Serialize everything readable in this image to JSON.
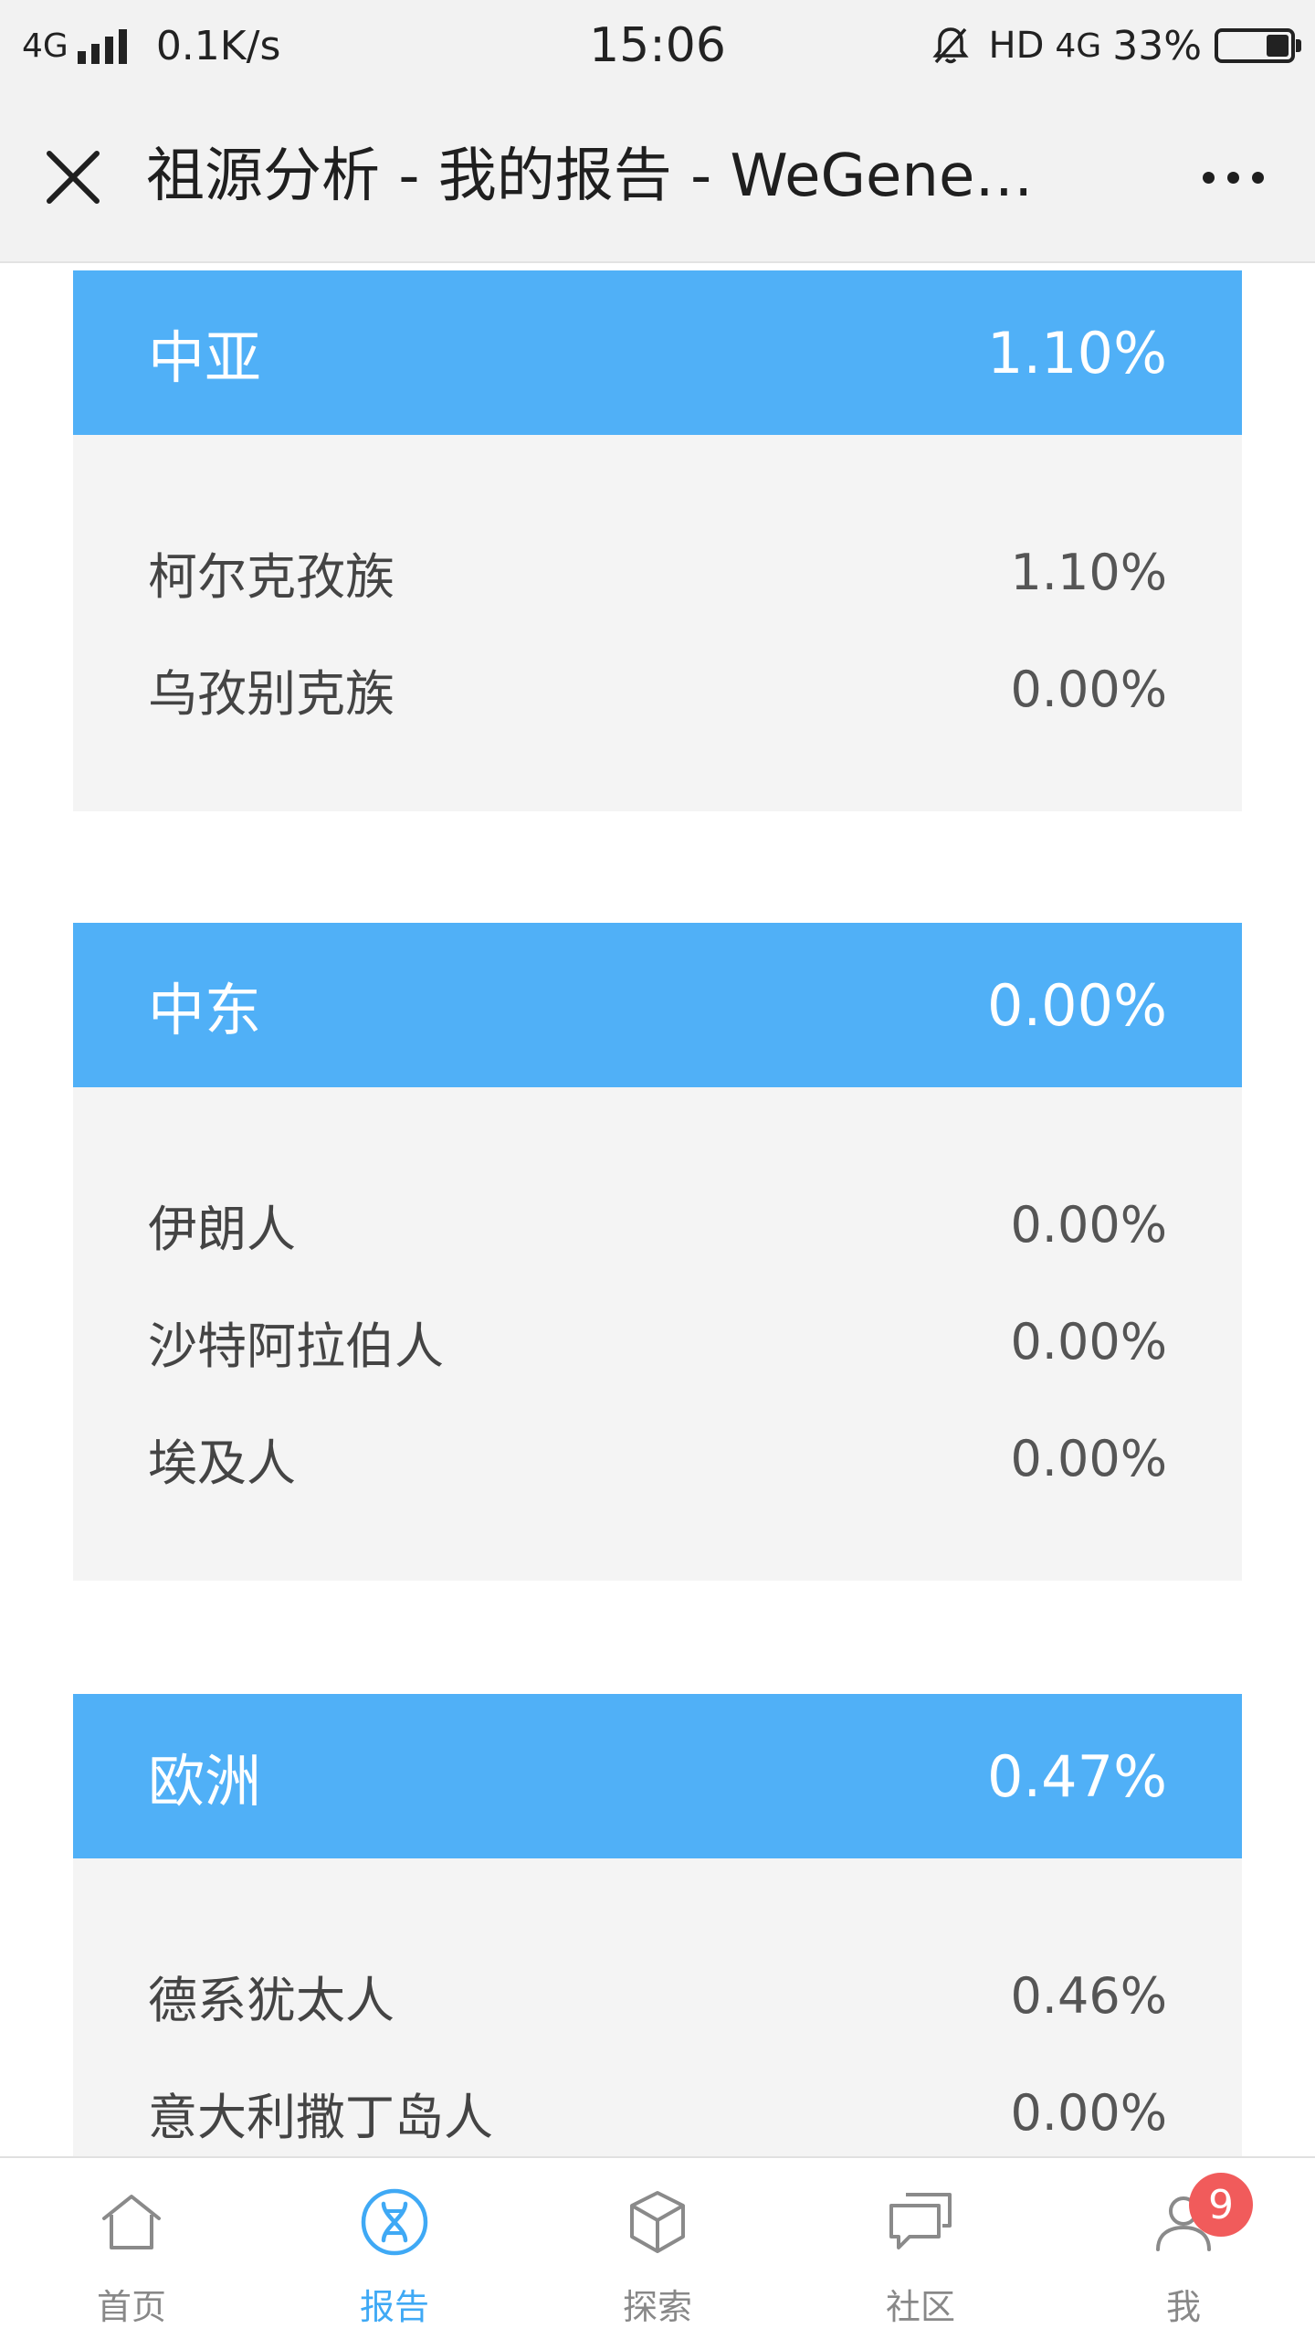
{
  "status_bar": {
    "network": "4G",
    "speed": "0.1K/s",
    "time": "15:06",
    "hd": "HD",
    "network_right": "4G",
    "battery_percent": "33%",
    "battery_level": 0.33
  },
  "title_bar": {
    "title": "祖源分析 - 我的报告 - WeGene…"
  },
  "regions": [
    {
      "name": "中亚",
      "percent": "1.10%",
      "items": [
        {
          "name": "柯尔克孜族",
          "percent": "1.10%"
        },
        {
          "name": "乌孜别克族",
          "percent": "0.00%"
        }
      ]
    },
    {
      "name": "中东",
      "percent": "0.00%",
      "items": [
        {
          "name": "伊朗人",
          "percent": "0.00%"
        },
        {
          "name": "沙特阿拉伯人",
          "percent": "0.00%"
        },
        {
          "name": "埃及人",
          "percent": "0.00%"
        }
      ]
    },
    {
      "name": "欧洲",
      "percent": "0.47%",
      "items": [
        {
          "name": "德系犹太人",
          "percent": "0.46%"
        },
        {
          "name": "意大利撒丁岛人",
          "percent": "0.00%"
        }
      ]
    }
  ],
  "tabs": [
    {
      "label": "首页",
      "icon": "home-icon"
    },
    {
      "label": "报告",
      "icon": "dna-icon",
      "active": true
    },
    {
      "label": "探索",
      "icon": "cube-icon"
    },
    {
      "label": "社区",
      "icon": "chat-icon"
    },
    {
      "label": "我",
      "icon": "user-icon",
      "badge": "9"
    }
  ],
  "colors": {
    "accent": "#50b0f7",
    "active_tab": "#3fa9f5",
    "badge": "#f15b5b",
    "card_body": "#f4f4f4"
  }
}
